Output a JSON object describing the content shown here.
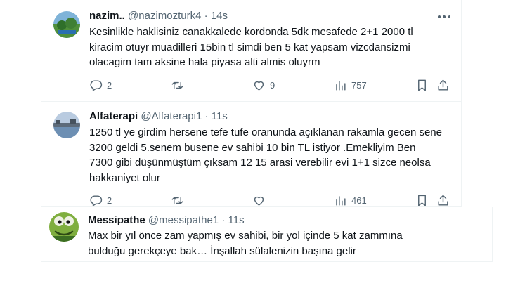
{
  "tweets": [
    {
      "name": "nazim..",
      "handle": "@nazimozturk4",
      "sep": "·",
      "time": "14s",
      "lines": [
        "Kesinlikle haklisiniz canakkalede kordonda 5dk mesafede 2+1 2000 tl",
        "kiracim otuyr muadilleri 15bin tl simdi ben 5 kat yapsam vizcdansizmi",
        "olacagim tam aksine hala piyasa alti almis oluyrm"
      ],
      "replies": "2",
      "retweets": "",
      "likes": "9",
      "views": "757"
    },
    {
      "name": "Alfaterapi",
      "handle": "@Alfaterapi1",
      "sep": "·",
      "time": "11s",
      "lines": [
        "1250 tl ye girdim hersene tefe tufe oranunda açıklanan rakamla gecen sene",
        "3200 geldi 5.senem busene ev sahibi 10 bin TL istiyor .Emekliyim Ben",
        "7300 gibi düşünmüştüm çıksam 12 15 arasi verebilir evi  1+1 sizce neolsa",
        "hakkaniyet olur"
      ],
      "replies": "2",
      "retweets": "",
      "likes": "",
      "views": "461"
    },
    {
      "name": "Messipathe",
      "handle": "@messipathe1",
      "sep": "·",
      "time": "11s",
      "lines": [
        "Max bir yıl önce zam yapmış ev sahibi, bir yol içinde 5 kat zammına",
        "bulduğu gerekçeye bak… İnşallah sülalenizin başına gelir"
      ]
    }
  ],
  "icons": {
    "more": "more-horizontal-icon",
    "reply": "reply-bubble-icon",
    "retweet": "retweet-icon",
    "like": "heart-icon",
    "views": "views-bar-chart-icon",
    "bookmark": "bookmark-icon",
    "share": "share-icon"
  },
  "colors": {
    "text": "#0f1419",
    "secondary": "#536471",
    "border": "#eff3f4"
  }
}
